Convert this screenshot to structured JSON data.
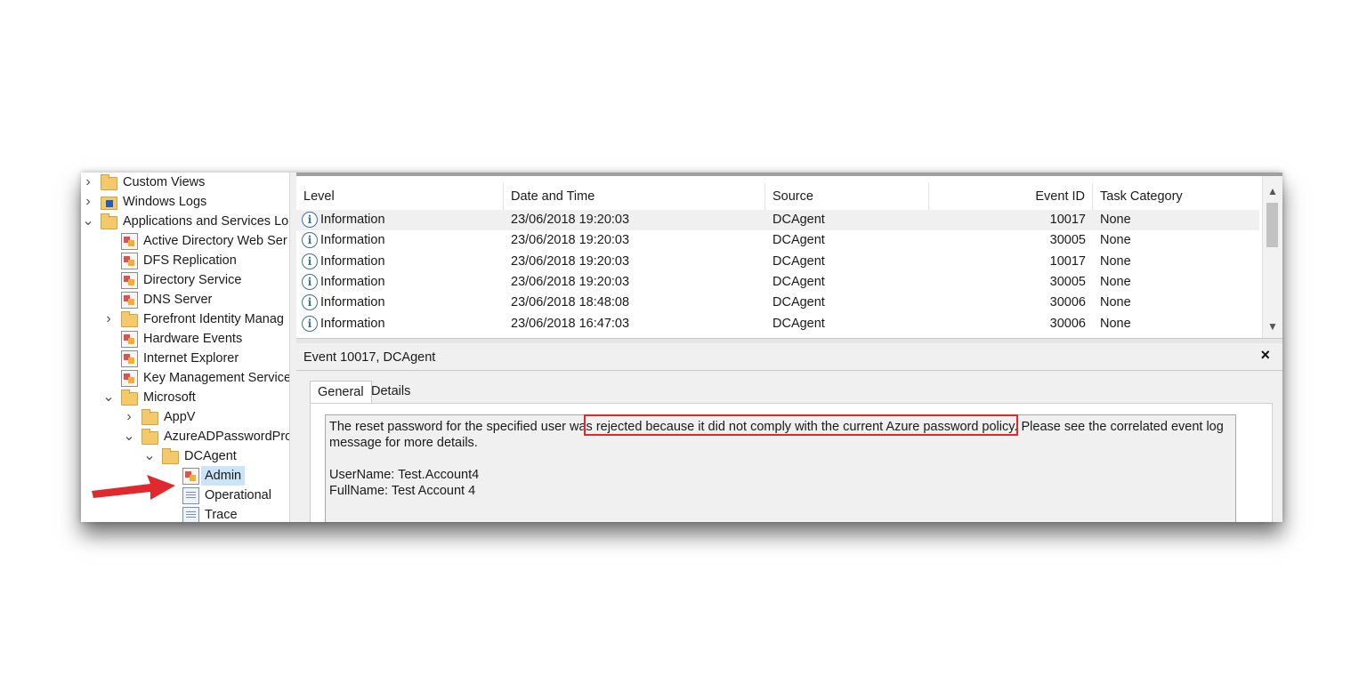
{
  "tree": {
    "items": [
      {
        "label": "Custom Views",
        "chevron": ">",
        "icon": "folder-icon"
      },
      {
        "label": "Windows Logs",
        "chevron": ">",
        "icon": "windows-logs-icon"
      },
      {
        "label": "Applications and Services Lo",
        "chevron": "v",
        "icon": "folder-icon"
      },
      {
        "label": "Active Directory Web Ser",
        "icon": "event-log-icon"
      },
      {
        "label": "DFS Replication",
        "icon": "event-log-icon"
      },
      {
        "label": "Directory Service",
        "icon": "event-log-icon"
      },
      {
        "label": "DNS Server",
        "icon": "event-log-icon"
      },
      {
        "label": "Forefront Identity Manag",
        "chevron": ">",
        "icon": "folder-icon"
      },
      {
        "label": "Hardware Events",
        "icon": "event-log-icon"
      },
      {
        "label": "Internet Explorer",
        "icon": "event-log-icon"
      },
      {
        "label": "Key Management Service",
        "icon": "event-log-icon"
      },
      {
        "label": "Microsoft",
        "chevron": "v",
        "icon": "folder-icon"
      },
      {
        "label": "AppV",
        "chevron": ">",
        "icon": "folder-icon"
      },
      {
        "label": "AzureADPasswordPro",
        "chevron": "v",
        "icon": "folder-icon"
      },
      {
        "label": "DCAgent",
        "chevron": "v",
        "icon": "folder-icon"
      },
      {
        "label": "Admin",
        "icon": "event-log-icon",
        "selected": true
      },
      {
        "label": "Operational",
        "icon": "log-icon"
      },
      {
        "label": "Trace",
        "icon": "log-icon"
      }
    ]
  },
  "list": {
    "columns": [
      "Level",
      "Date and Time",
      "Source",
      "Event ID",
      "Task Category"
    ],
    "rows": [
      {
        "level": "Information",
        "datetime": "23/06/2018 19:20:03",
        "source": "DCAgent",
        "event_id": "10017",
        "category": "None"
      },
      {
        "level": "Information",
        "datetime": "23/06/2018 19:20:03",
        "source": "DCAgent",
        "event_id": "30005",
        "category": "None"
      },
      {
        "level": "Information",
        "datetime": "23/06/2018 19:20:03",
        "source": "DCAgent",
        "event_id": "10017",
        "category": "None"
      },
      {
        "level": "Information",
        "datetime": "23/06/2018 19:20:03",
        "source": "DCAgent",
        "event_id": "30005",
        "category": "None"
      },
      {
        "level": "Information",
        "datetime": "23/06/2018 18:48:08",
        "source": "DCAgent",
        "event_id": "30006",
        "category": "None"
      },
      {
        "level": "Information",
        "datetime": "23/06/2018 16:47:03",
        "source": "DCAgent",
        "event_id": "30006",
        "category": "None"
      }
    ],
    "info_glyph": "i"
  },
  "detail": {
    "title": "Event 10017, DCAgent",
    "close": "×",
    "tabs": [
      "General",
      "Details"
    ],
    "message_before": "The reset password for the specified user was ",
    "message_highlight": "rejected because it did not comply with the current Azure password policy.",
    "message_after": " Please see the correlated event log message for more details.",
    "username_line": "UserName: Test.Account4",
    "fullname_line": "FullName: Test Account 4"
  },
  "colors": {
    "highlight": "#e0282d",
    "arrow": "#e0282d",
    "selection": "#cce4f7"
  }
}
